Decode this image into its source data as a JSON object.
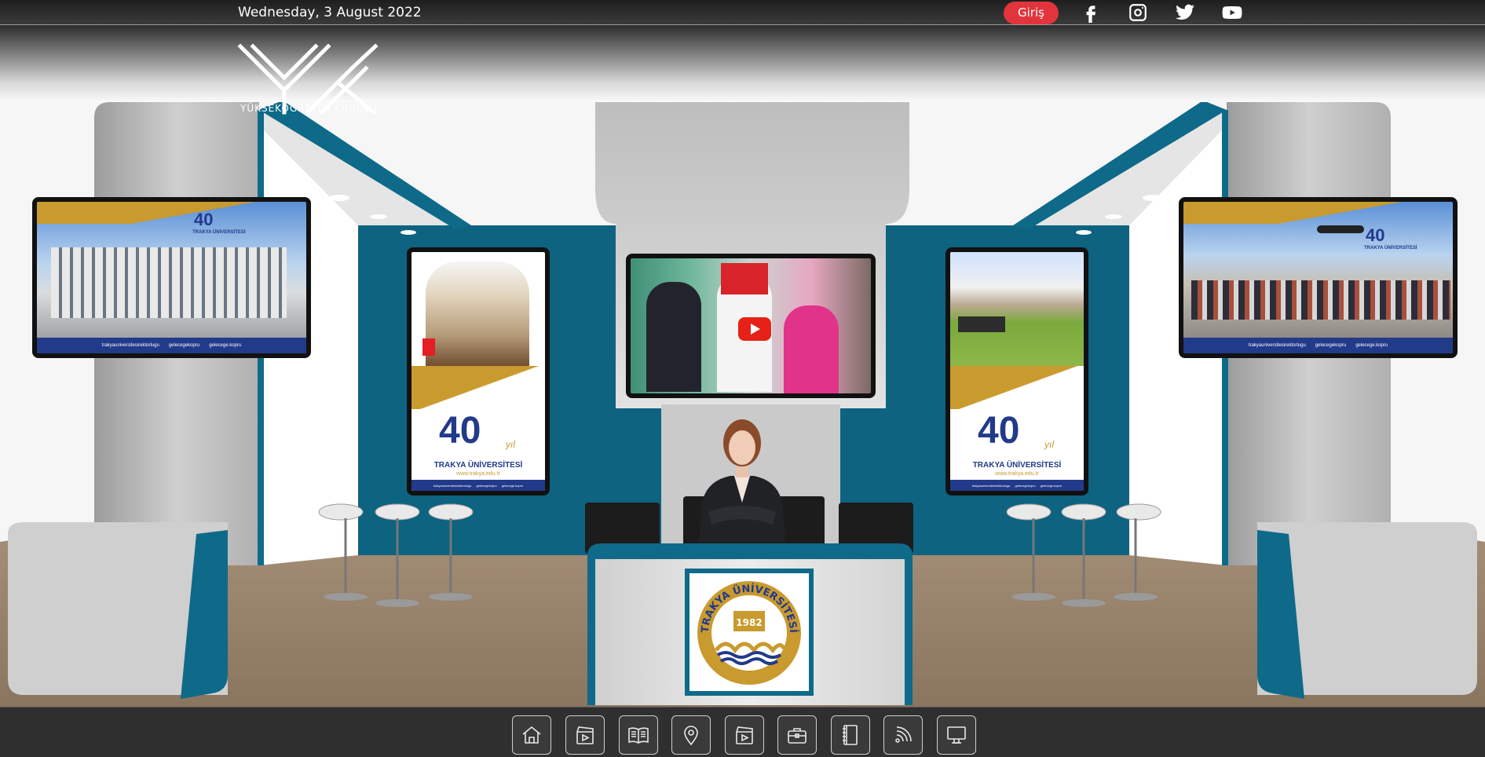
{
  "topbar": {
    "date": "Wednesday, 3 August 2022",
    "login_label": "Giriş",
    "social_icons": [
      "facebook-icon",
      "instagram-icon",
      "twitter-icon",
      "youtube-icon"
    ]
  },
  "logo": {
    "text": "YÜKSEKÖĞRETİM KURULU"
  },
  "booth": {
    "left_panel": {
      "badge": "40",
      "university": "TRAKYA ÜNİVERSİTESİ",
      "footer": [
        "trakyauniversitesirektorlugu",
        "gelecegekopru",
        "gelecege.kopru"
      ]
    },
    "left_banner": {
      "badge": "40",
      "badge_suffix": "yıl",
      "university": "TRAKYA ÜNİVERSİTESİ",
      "website": "www.trakya.edu.tr",
      "footer": [
        "trakyauniversitesirektorlugu",
        "gelecegekopru",
        "gelecege.kopru"
      ]
    },
    "right_banner": {
      "badge": "40",
      "badge_suffix": "yıl",
      "university": "TRAKYA ÜNİVERSİTESİ",
      "website": "www.trakya.edu.tr",
      "footer": [
        "trakyauniversitesirektorlugu",
        "gelecegekopru",
        "gelecege.kopru"
      ]
    },
    "right_panel": {
      "badge": "40",
      "university": "TRAKYA ÜNİVERSİTESİ",
      "footer": [
        "trakyauniversitesirektorlugu",
        "gelecegekopru",
        "gelecege.kopru"
      ]
    },
    "desk_emblem": {
      "arc_text": "TRAKYA ÜNİVERSİTESİ",
      "year": "1982"
    }
  },
  "colors": {
    "teal": "#0e6a88",
    "gold": "#c99a2e",
    "navy": "#223a8a",
    "youtube_red": "#e62117",
    "login_red": "#e2343c"
  },
  "bottom_nav": [
    "home-icon",
    "video-icon",
    "book-icon",
    "location-icon",
    "video-icon",
    "briefcase-icon",
    "notebook-icon",
    "broadcast-icon",
    "monitor-icon"
  ]
}
